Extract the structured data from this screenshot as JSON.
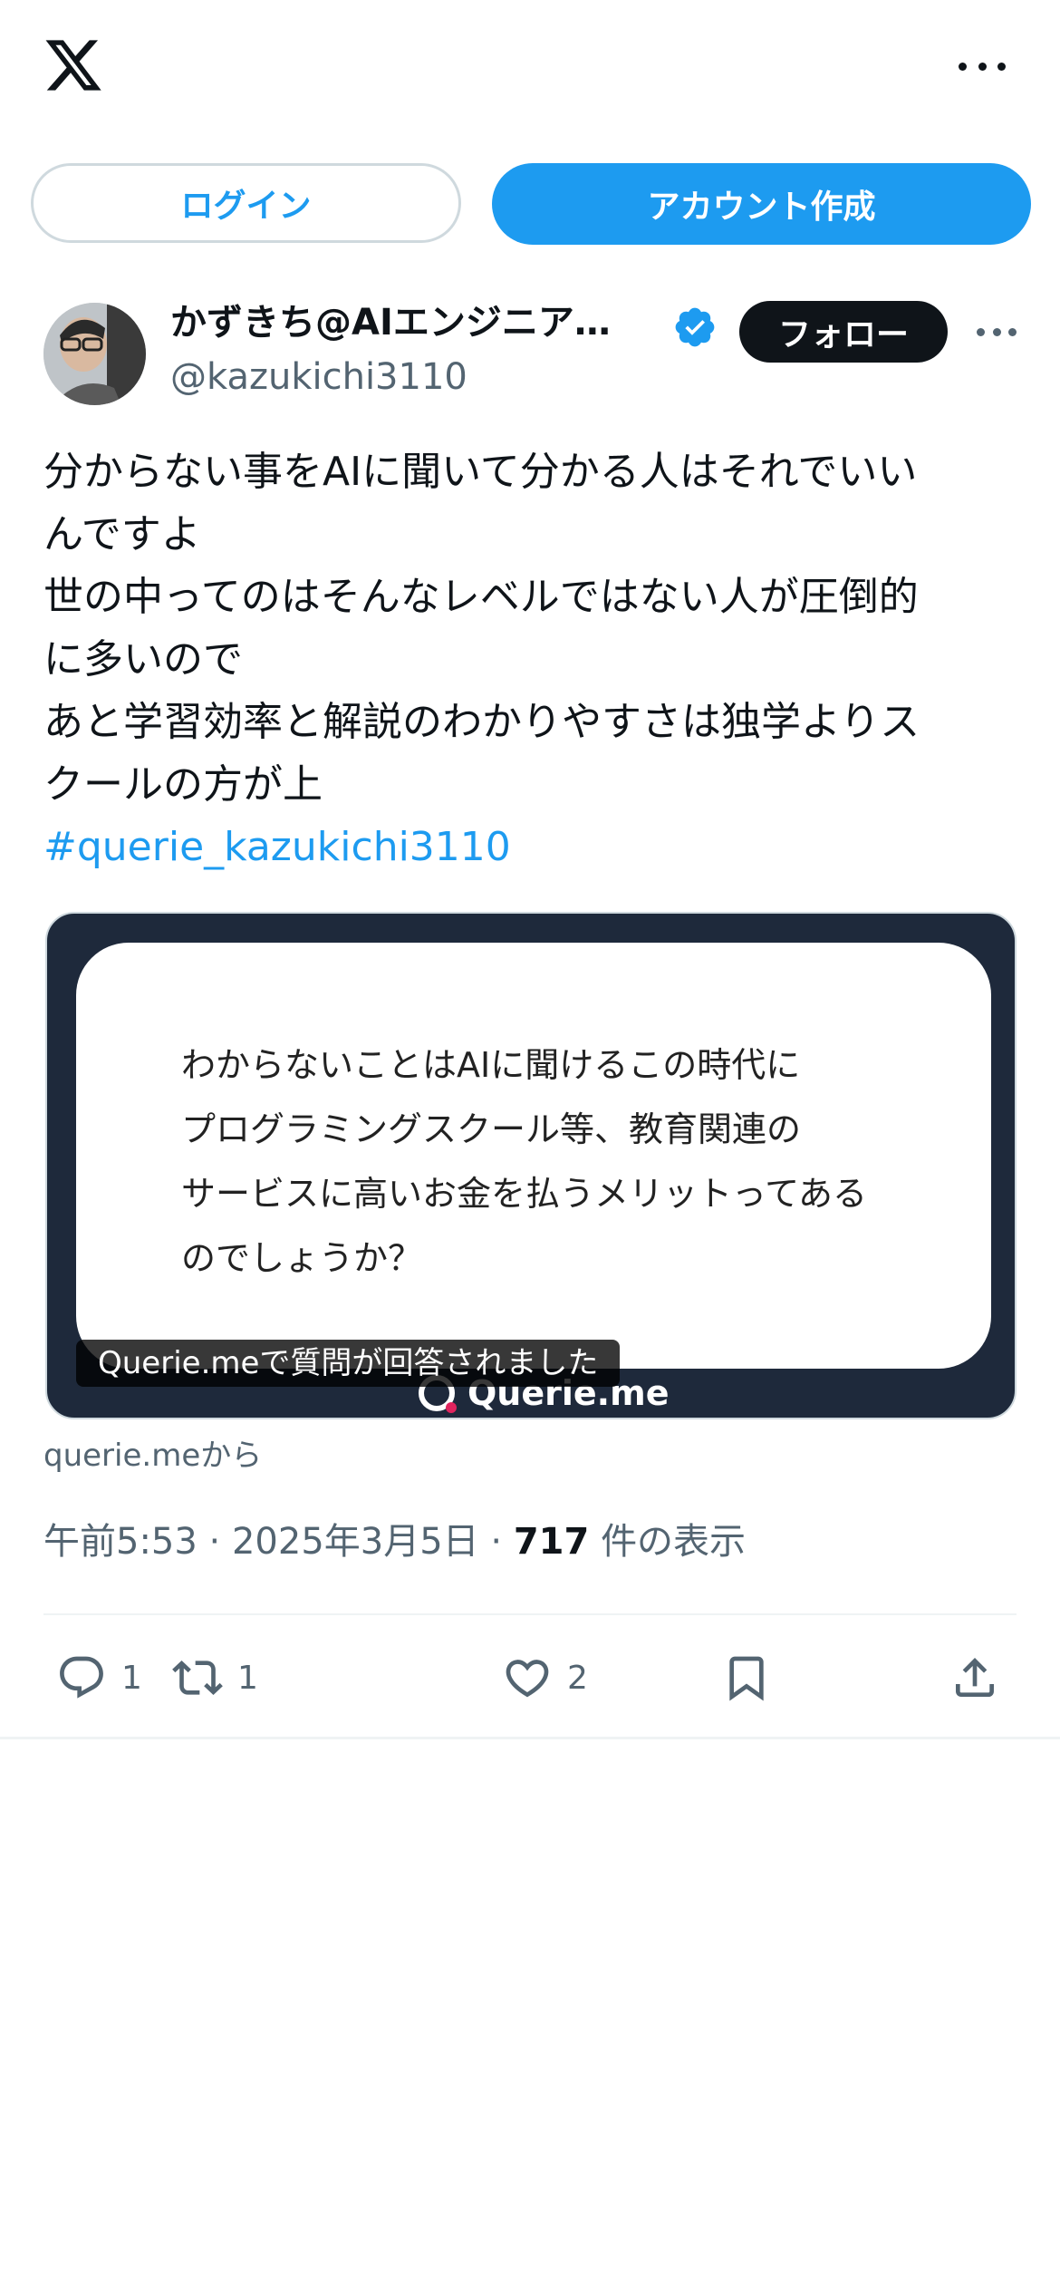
{
  "nav": {
    "logo_icon": "x-logo-icon",
    "more_icon": "more-horizontal-icon"
  },
  "auth": {
    "login_label": "ログイン",
    "signup_label": "アカウント作成"
  },
  "tweet": {
    "author_name": "かずきち@AIエンジニア…",
    "handle": "@kazukichi3110",
    "follow_label": "フォロー",
    "text_lines": [
      "分からない事をAIに聞いて分かる人はそれでいい",
      "んですよ",
      "世の中ってのはそんなレベルではない人が圧倒的",
      "に多いので",
      "あと学習効率と解説のわかりやすさは独学よりス",
      "クールの方が上"
    ],
    "hashtag": "#querie_kazukichi3110",
    "card": {
      "question_lines": [
        "わからないことはAIに聞けるこの時代に",
        "プログラミングスクール等、教育関連の",
        "サービスに高いお金を払うメリットってある",
        "のでしょうか？"
      ],
      "brand": "Querie.me",
      "caption": "Querie.meで質問が回答されました"
    },
    "source": "querie.meから",
    "time": "午前5:53",
    "date": "2025年3月5日",
    "views": "717",
    "views_label": "件の表示",
    "stats": {
      "replies": "1",
      "retweets": "1",
      "likes": "2"
    }
  },
  "colors": {
    "accent": "#1d9bf0",
    "text": "#0f1419",
    "muted": "#536471",
    "card_bg": "#1e293b"
  }
}
